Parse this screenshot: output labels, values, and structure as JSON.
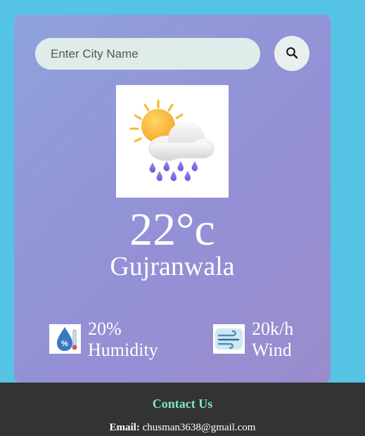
{
  "search": {
    "placeholder": "Enter City Name",
    "button_icon": "search-icon"
  },
  "weather": {
    "icon": "sun-cloud-rain-icon",
    "temperature": "22°c",
    "city": "Gujranwala"
  },
  "details": {
    "humidity": {
      "value": "20%",
      "label": "Humidity",
      "icon": "humidity-icon"
    },
    "wind": {
      "value": "20k/h",
      "label": "Wind",
      "icon": "wind-icon"
    }
  },
  "footer": {
    "title": "Contact Us",
    "email_label": "Email:",
    "email": "chusman3638@gmail.com"
  },
  "colors": {
    "page_bg": "#55c3e3",
    "card_gradient_start": "#8fa2db",
    "card_gradient_end": "#9a8ccc",
    "footer_bg": "#333333",
    "footer_title": "#7fe7c8"
  }
}
